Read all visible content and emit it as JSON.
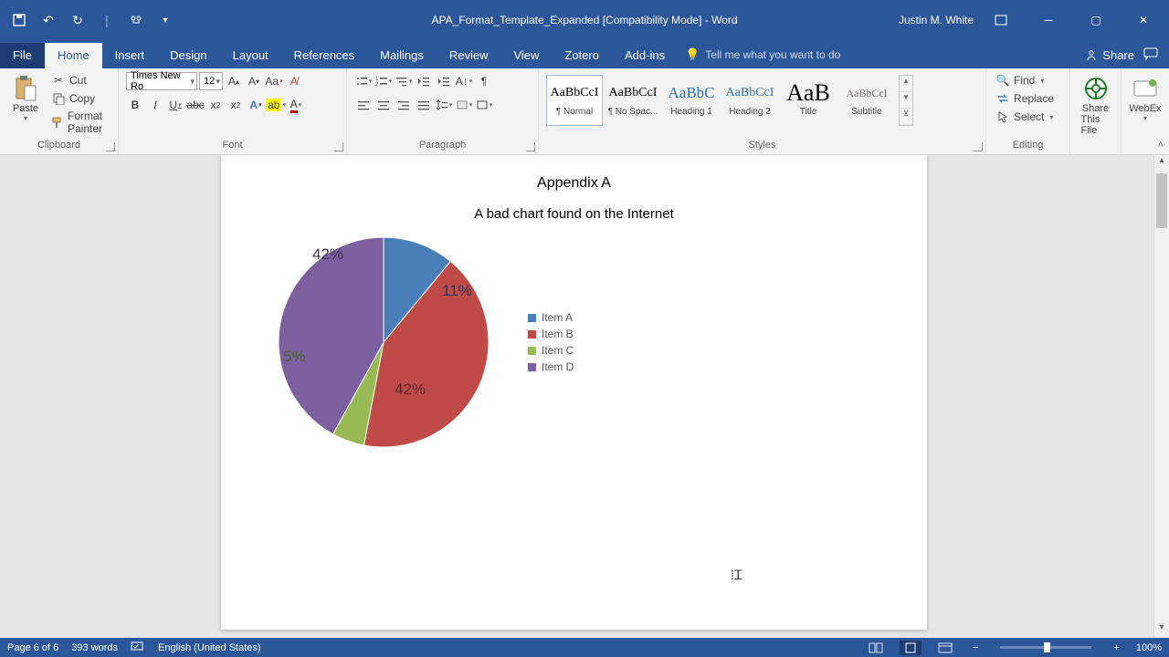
{
  "titlebar": {
    "doc_title": "APA_Format_Template_Expanded [Compatibility Mode]  -  Word",
    "user": "Justin M. White"
  },
  "tabs": {
    "file": "File",
    "home": "Home",
    "insert": "Insert",
    "design": "Design",
    "layout": "Layout",
    "references": "References",
    "mailings": "Mailings",
    "review": "Review",
    "view": "View",
    "zotero": "Zotero",
    "addins": "Add-ins",
    "tellme": "Tell me what you want to do",
    "share": "Share"
  },
  "clipboard": {
    "paste": "Paste",
    "cut": "Cut",
    "copy": "Copy",
    "format_painter": "Format Painter",
    "label": "Clipboard"
  },
  "font": {
    "name": "Times New Ro",
    "size": "12",
    "label": "Font"
  },
  "paragraph": {
    "label": "Paragraph"
  },
  "styles": {
    "label": "Styles",
    "items": [
      {
        "preview": "AaBbCcI",
        "name": "¶ Normal",
        "size": "14px",
        "color": "#000",
        "selected": true
      },
      {
        "preview": "AaBbCcI",
        "name": "¶ No Spac...",
        "size": "14px",
        "color": "#000"
      },
      {
        "preview": "AaBbC",
        "name": "Heading 1",
        "size": "17px",
        "color": "#2e74b5"
      },
      {
        "preview": "AaBbCcI",
        "name": "Heading 2",
        "size": "14px",
        "color": "#2e74b5"
      },
      {
        "preview": "AaB",
        "name": "Title",
        "size": "26px",
        "color": "#000"
      },
      {
        "preview": "AaBbCcI",
        "name": "Subtitle",
        "size": "12px",
        "color": "#767171"
      }
    ]
  },
  "editing": {
    "find": "Find",
    "replace": "Replace",
    "select": "Select",
    "label": "Editing"
  },
  "sharegrp": {
    "share_file": "Share",
    "share_file2": "This File",
    "webex": "WebEx"
  },
  "document": {
    "heading": "Appendix A",
    "subheading": "A bad chart found on the Internet"
  },
  "chart_data": {
    "type": "pie",
    "title": "",
    "series": [
      {
        "name": "Item A",
        "value": 11,
        "label": "11%",
        "color": "#4a7ebb"
      },
      {
        "name": "Item B",
        "value": 42,
        "label": "42%",
        "color": "#be4b48"
      },
      {
        "name": "Item C",
        "value": 5,
        "label": "5%",
        "color": "#98b954"
      },
      {
        "name": "Item D",
        "value": 42,
        "label": "42%",
        "color": "#7d60a0"
      }
    ]
  },
  "status": {
    "page": "Page 6 of 6",
    "words": "393 words",
    "lang": "English (United States)",
    "zoom": "100%"
  }
}
